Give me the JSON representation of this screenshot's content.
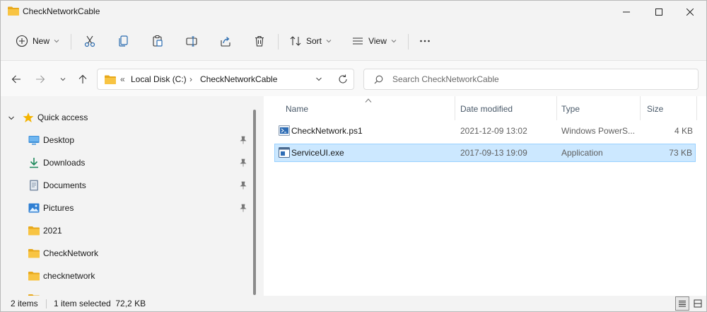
{
  "window": {
    "title": "CheckNetworkCable"
  },
  "toolbar": {
    "new_label": "New",
    "sort_label": "Sort",
    "view_label": "View"
  },
  "address": {
    "overflow": "«",
    "crumbs": [
      "Local Disk (C:)",
      "CheckNetworkCable"
    ],
    "separator": "›"
  },
  "search": {
    "placeholder": "Search CheckNetworkCable"
  },
  "sidebar": {
    "items": [
      {
        "label": "Quick access",
        "icon": "star-icon"
      },
      {
        "label": "Desktop",
        "icon": "desktop-icon",
        "pinned": true
      },
      {
        "label": "Downloads",
        "icon": "download-icon",
        "pinned": true
      },
      {
        "label": "Documents",
        "icon": "documents-icon",
        "pinned": true
      },
      {
        "label": "Pictures",
        "icon": "pictures-icon",
        "pinned": true
      },
      {
        "label": "2021",
        "icon": "folder-icon"
      },
      {
        "label": "CheckNetwork",
        "icon": "folder-icon"
      },
      {
        "label": "checknetwork",
        "icon": "folder-icon"
      }
    ]
  },
  "files": {
    "columns": [
      "Name",
      "Date modified",
      "Type",
      "Size"
    ],
    "rows": [
      {
        "name": "CheckNetwork.ps1",
        "date": "2021-12-09 13:02",
        "type": "Windows PowerS...",
        "size": "4 KB",
        "icon": "powershell-script-icon",
        "selected": false
      },
      {
        "name": "ServiceUI.exe",
        "date": "2017-09-13 19:09",
        "type": "Application",
        "size": "73 KB",
        "icon": "application-icon",
        "selected": true
      }
    ]
  },
  "status": {
    "item_count": "2 items",
    "selection": "1 item selected  72,2 KB"
  },
  "colors": {
    "folder": "#f8c443",
    "accent": "#0067c0",
    "selection_bg": "#cce8ff",
    "selection_border": "#99d1ff"
  }
}
